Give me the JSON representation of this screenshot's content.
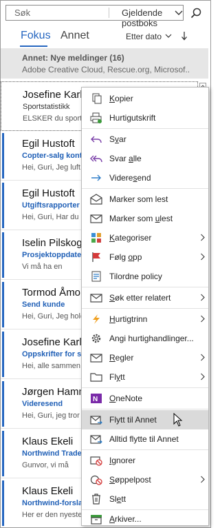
{
  "search": {
    "placeholder": "Søk",
    "scope": "Gjeldende postboks"
  },
  "tabs": {
    "focused": "Fokus",
    "other": "Annet"
  },
  "sort": {
    "label": "Etter dato"
  },
  "other_banner": {
    "title": "Annet: Nye meldinger (16)",
    "subtitle": "Adobe Creative Cloud, Rescue.org, Microsof..."
  },
  "emails": [
    {
      "sender": "Josefine Karls",
      "subject": "Sportstatistikk",
      "preview": "ELSKER du sport?"
    },
    {
      "sender": "Egil Hustoft",
      "subject": "Copter-salg kont",
      "preview": "Hei, Guri, Jeg luft"
    },
    {
      "sender": "Egil Hustoft",
      "subject": "Utgiftsrapporter",
      "preview": "Hei, Guri, Har du"
    },
    {
      "sender": "Iselin Pilskog",
      "subject": "Prosjektoppdater",
      "preview": "Vi må ha en"
    },
    {
      "sender": "Tormod Åmo",
      "subject": "Send kunde",
      "preview": "Hei, Guri, Jeg hold"
    },
    {
      "sender": "Josefine Karls",
      "subject": "Oppskrifter for s",
      "preview": "Hei, alle sammen,"
    },
    {
      "sender": "Jørgen Hamm",
      "subject": "Videresend",
      "preview": "Hei, Guri, jeg tror"
    },
    {
      "sender": "Klaus Ekeli",
      "subject": "Northwind Trade",
      "preview": "Gunvor, vi må"
    },
    {
      "sender": "Klaus Ekeli",
      "subject": "Northwind-forsla",
      "preview": "Her er den nyeste"
    }
  ],
  "menu": {
    "copy": {
      "pre": "",
      "u": "K",
      "post": "opier"
    },
    "quick_print": {
      "label": "Hurtigutskrift"
    },
    "reply": {
      "pre": "S",
      "u": "v",
      "post": "ar"
    },
    "reply_all": {
      "pre": "Svar ",
      "u": "a",
      "post": "lle"
    },
    "forward": {
      "pre": "Videre",
      "u": "s",
      "post": "end"
    },
    "mark_read": {
      "label": "Marker som lest"
    },
    "mark_unread": {
      "pre": "Marker som ",
      "u": "u",
      "post": "lest"
    },
    "categorize": {
      "pre": "",
      "u": "K",
      "post": "ategoriser"
    },
    "follow_up": {
      "pre": "Følg ",
      "u": "o",
      "post": "pp"
    },
    "assign_policy": {
      "label": "Tilordne policy"
    },
    "find_related": {
      "pre": "",
      "u": "S",
      "post": "øk etter relatert"
    },
    "quick_steps": {
      "pre": "",
      "u": "H",
      "post": "urtigtrinn"
    },
    "set_quick_actions": {
      "label": "Angi hurtighandlinger..."
    },
    "rules": {
      "pre": "",
      "u": "R",
      "post": "egler"
    },
    "move": {
      "pre": "Fl",
      "u": "y",
      "post": "tt"
    },
    "onenote": {
      "pre": "",
      "u": "O",
      "post": "neNote"
    },
    "move_to_other": {
      "label": "Flytt til Annet"
    },
    "always_move_to_other": {
      "label": "Alltid flytte til Annet"
    },
    "ignore": {
      "pre": "",
      "u": "I",
      "post": "gnorer"
    },
    "junk": {
      "pre": "",
      "u": "S",
      "post": "øppelpost"
    },
    "delete": {
      "pre": "Sl",
      "u": "e",
      "post": "tt"
    },
    "archive": {
      "pre": "",
      "u": "A",
      "post": "rkiver..."
    }
  },
  "colors": {
    "accent": "#2566c0",
    "highlight": "#dadada",
    "banner": "#e6e6e6"
  }
}
